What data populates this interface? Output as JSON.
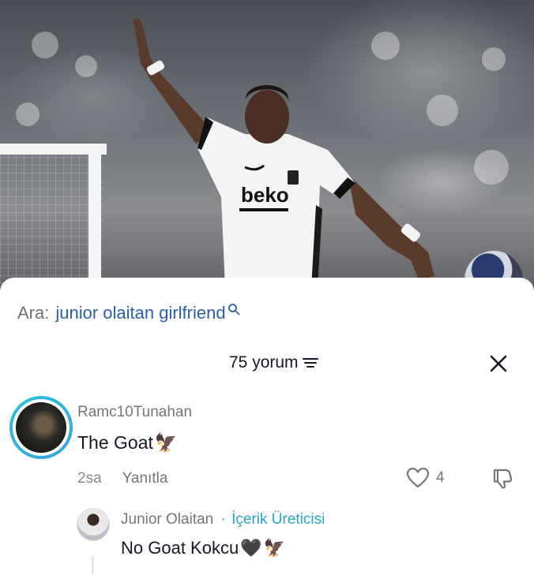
{
  "search": {
    "prefix": "Ara:",
    "term": "junior olaitan girlfriend"
  },
  "header": {
    "comment_count_label": "75 yorum"
  },
  "comments": [
    {
      "username": "Ramc10Tunahan",
      "text": "The Goat",
      "emoji": "🦅",
      "time": "2sa",
      "reply_label": "Yanıtla",
      "likes": "4"
    }
  ],
  "reply": {
    "username": "Junior Olaitan",
    "separator": "·",
    "badge": "İçerik Üreticisi",
    "text": "No Goat Kokcu",
    "emoji_heart": "🖤",
    "emoji_eagle": "🦅"
  },
  "colors": {
    "search_term": "#2b5fa8",
    "creator_badge": "#25a6c6",
    "avatar_ring": "#27c4d9"
  },
  "icons": {
    "search": "magnifier-icon",
    "filter": "filter-lines-icon",
    "close": "close-x-icon",
    "like": "heart-outline-icon",
    "dislike": "thumbs-down-icon"
  }
}
